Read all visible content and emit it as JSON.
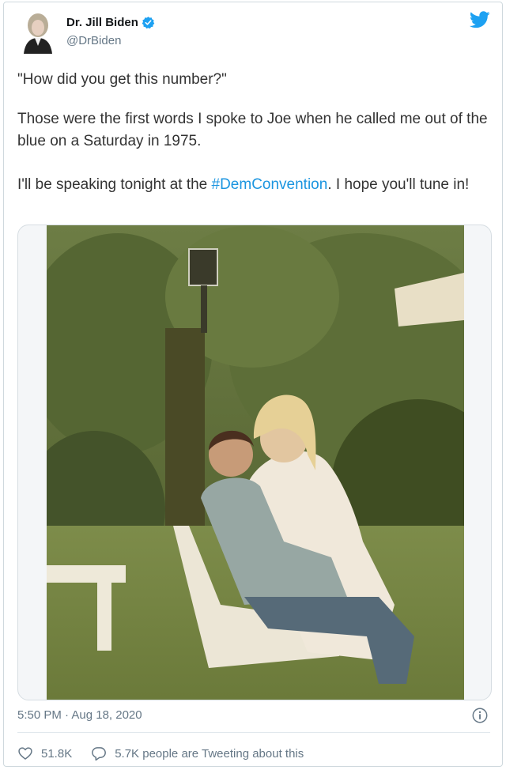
{
  "author": {
    "display_name": "Dr. Jill Biden",
    "handle": "@DrBiden",
    "verified": true
  },
  "tweet": {
    "paragraph_1": "\"How did you get this number?\"",
    "paragraph_2": "Those were the first words I spoke to Joe when he called me out of the blue on a Saturday in 1975.",
    "paragraph_3_before": "I'll be speaking tonight at the ",
    "hashtag": "#DemConvention",
    "paragraph_3_after": ". I hope you'll tune in!"
  },
  "meta": {
    "timestamp": "5:50 PM · Aug 18, 2020"
  },
  "stats": {
    "likes": "51.8K",
    "tweeting": "5.7K people are Tweeting about this"
  },
  "colors": {
    "twitter_blue": "#1da1f2",
    "link_blue": "#1b95e0",
    "secondary_text": "#657786"
  },
  "icons": {
    "logo": "twitter-bird-icon",
    "verified": "verified-badge-icon",
    "like": "heart-icon",
    "reply": "speech-bubble-icon",
    "info": "info-icon"
  }
}
